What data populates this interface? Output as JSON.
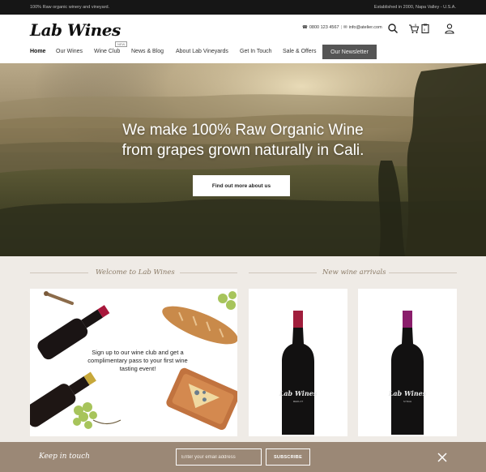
{
  "topbar": {
    "left_text": "100% Raw organic winery and vineyard.",
    "right_text": "Established in 2000, Napa Valley - U.S.A."
  },
  "header": {
    "logo": "Lab Wines",
    "phone": "0800 123 4567",
    "separator": "|",
    "email": "info@atelier.com",
    "icons": [
      "search-icon",
      "cart-icon",
      "clipboard-icon",
      "user-icon"
    ],
    "cart_count": "0",
    "list_count": "0"
  },
  "nav": {
    "items": [
      "Home",
      "Our Wines",
      "Wine Club",
      "News & Blog",
      "About Lab Vineyards",
      "Get In Touch",
      "Sale & Offers"
    ],
    "badge": "NEW",
    "cta": "Our Newsletter"
  },
  "hero": {
    "line1": "We make 100% Raw Organic Wine",
    "line2": "from grapes grown naturally in Cali.",
    "button": "Find out more about us"
  },
  "sections": {
    "welcome_title": "Welcome to Lab Wines",
    "arrivals_title": "New wine arrivals"
  },
  "promo": {
    "text": "Sign up to our wine club and get a complimentary pass to your first wine tasting event!"
  },
  "products": [
    {
      "label_logo": "Lab Wines",
      "label_type": "MERLOT"
    },
    {
      "label_logo": "Lab Wines",
      "label_type": "SYRAH"
    }
  ],
  "footer": {
    "title": "Keep in touch",
    "email_placeholder": "Enter your email address",
    "subscribe": "SUBSCRIBE"
  },
  "colors": {
    "topbar": "#161616",
    "accent_brown": "#9b8876",
    "cta_gray": "#555555",
    "section_bg": "#efebe6"
  }
}
